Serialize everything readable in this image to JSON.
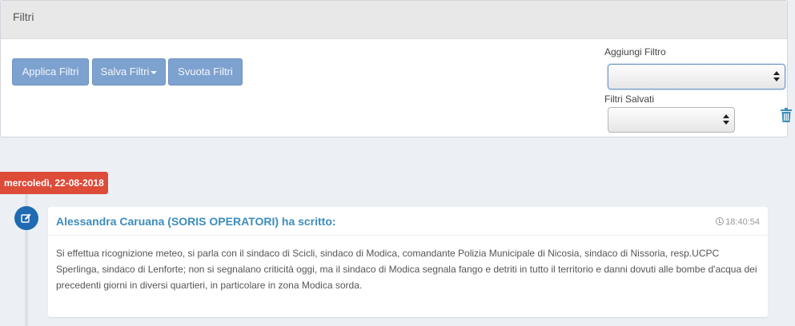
{
  "filters_panel": {
    "title": "Filtri",
    "buttons": {
      "apply": "Applica Filtri",
      "save": "Salva Filtri",
      "clear": "Svuota Filtri"
    },
    "add_filter": {
      "label": "Aggiungi Filtro",
      "value": ""
    },
    "saved_filters": {
      "label": "Filtri Salvati",
      "value": ""
    },
    "delete_icon": "trash-icon"
  },
  "timeline": {
    "date_label": "mercoledì, 22-08-2018",
    "entries": [
      {
        "icon": "edit-icon",
        "author": "Alessandra Caruana (SORIS OPERATORI) ha scritto:",
        "time": "18:40:54",
        "body": "Si effettua ricognizione meteo, si parla con il sindaco di Scicli, sindaco di Modica, comandante Polizia Municipale di Nicosia, sindaco di Nissoria, resp.UCPC Sperlinga, sindaco di Lenforte; non si segnalano criticità oggi, ma il sindaco di Modica segnala fango e detriti in tutto il territorio e danni dovuti alle bombe d'acqua dei precedenti giorni in diversi quartieri, in particolare in zona Modica sorda."
      }
    ]
  },
  "colors": {
    "button_bg": "#7ea2cf",
    "date_badge": "#dd4b39",
    "author_text": "#3c8dbc",
    "timeline_icon": "#1f6ab1",
    "page_bg": "#ecf0f5"
  }
}
